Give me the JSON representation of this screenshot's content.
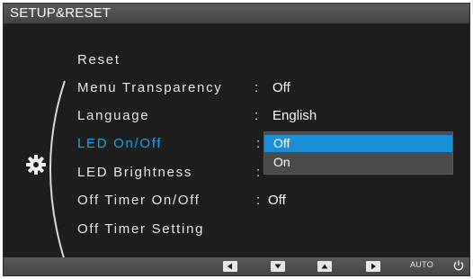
{
  "window": {
    "title": "SETUP&RESET"
  },
  "menu": {
    "items": [
      {
        "label": "Reset",
        "value": ""
      },
      {
        "label": "Menu Transparency",
        "value": "Off"
      },
      {
        "label": "Language",
        "value": "English"
      },
      {
        "label": "LED On/Off",
        "value": "",
        "active": true
      },
      {
        "label": "LED Brightness",
        "value": ""
      },
      {
        "label": "Off Timer On/Off",
        "value": "Off"
      },
      {
        "label": "Off Timer Setting",
        "value": ""
      }
    ],
    "separator": ":",
    "section_icon": "gear-icon"
  },
  "dropdown": {
    "options": [
      "Off",
      "On"
    ],
    "selected": "Off"
  },
  "bottom_bar": {
    "buttons": [
      "left-arrow-icon",
      "down-arrow-icon",
      "up-arrow-icon",
      "right-arrow-icon"
    ],
    "auto_label": "AUTO",
    "power_icon": "power-icon"
  },
  "colors": {
    "active_text": "#1aa4e8",
    "selected_option_bg": "#1b8fd6",
    "panel_bg": "#1e1e1e"
  }
}
